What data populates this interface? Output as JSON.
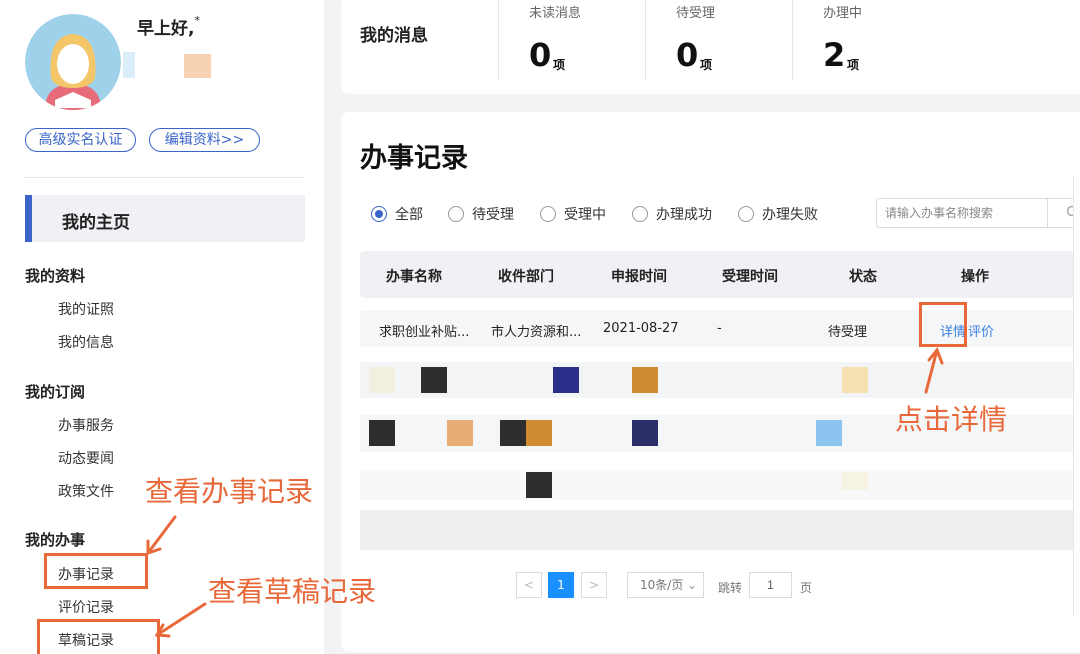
{
  "profile": {
    "greeting": "早上好,",
    "greeting_mark": "*",
    "verify_btn": "高级实名认证",
    "edit_btn": "编辑资料>>"
  },
  "sidebar": {
    "home": "我的主页",
    "sections": [
      {
        "title": "我的资料",
        "items": [
          "我的证照",
          "我的信息"
        ]
      },
      {
        "title": "我的订阅",
        "items": [
          "办事服务",
          "动态要闻",
          "政策文件"
        ]
      },
      {
        "title": "我的办事",
        "items": [
          "办事记录",
          "评价记录",
          "草稿记录"
        ]
      }
    ]
  },
  "messages": {
    "title": "我的消息",
    "stats": [
      {
        "label": "未读消息",
        "value": "0",
        "unit": "项"
      },
      {
        "label": "待受理",
        "value": "0",
        "unit": "项"
      },
      {
        "label": "办理中",
        "value": "2",
        "unit": "项"
      }
    ]
  },
  "records": {
    "title": "办事记录",
    "filters": [
      "全部",
      "待受理",
      "受理中",
      "办理成功",
      "办理失败"
    ],
    "selected_filter": "全部",
    "search_placeholder": "请输入办事名称搜索",
    "columns": [
      "办事名称",
      "收件部门",
      "申报时间",
      "受理时间",
      "状态",
      "操作"
    ],
    "rows": [
      {
        "name": "求职创业补贴...",
        "dept": "市人力资源和...",
        "date": "2021-08-27",
        "accept": "-",
        "status": "待受理",
        "action_detail": "详情",
        "action_rate": "评价"
      }
    ]
  },
  "pagination": {
    "prev": "<",
    "current": "1",
    "next": ">",
    "page_size": "10条/页",
    "jump_label": "跳转",
    "jump_value": "1",
    "page_unit": "页"
  },
  "annotations": {
    "view_records": "查看办事记录",
    "view_drafts": "查看草稿记录",
    "click_detail": "点击详情"
  },
  "colors": {
    "accent": "#3a64c7",
    "annotation": "#e8683a",
    "link": "#3a80e0"
  }
}
